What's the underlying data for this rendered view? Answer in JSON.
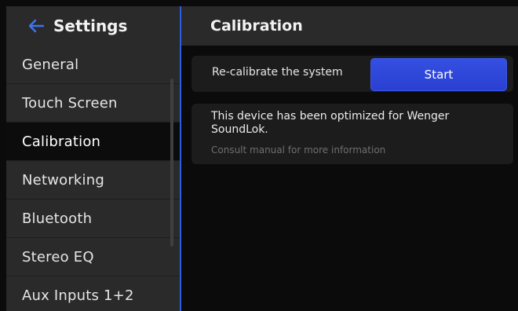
{
  "sidebar": {
    "title": "Settings",
    "back_icon": "arrow-left-icon",
    "items": [
      {
        "label": "General",
        "active": false
      },
      {
        "label": "Touch Screen",
        "active": false
      },
      {
        "label": "Calibration",
        "active": true
      },
      {
        "label": "Networking",
        "active": false
      },
      {
        "label": "Bluetooth",
        "active": false
      },
      {
        "label": "Stereo EQ",
        "active": false
      },
      {
        "label": "Aux Inputs 1+2",
        "active": false
      }
    ]
  },
  "main": {
    "title": "Calibration",
    "calibrate_row": {
      "label": "Re-calibrate the system",
      "button_label": "Start"
    },
    "info": {
      "text": "This device has been optimized for Wenger SoundLok.",
      "subtext": "Consult manual for more information"
    }
  },
  "colors": {
    "accent": "#2d5de0",
    "button": "#3048d9",
    "panel": "#2a2a2b",
    "card": "#1c1c1d",
    "background": "#0b0b0c"
  }
}
